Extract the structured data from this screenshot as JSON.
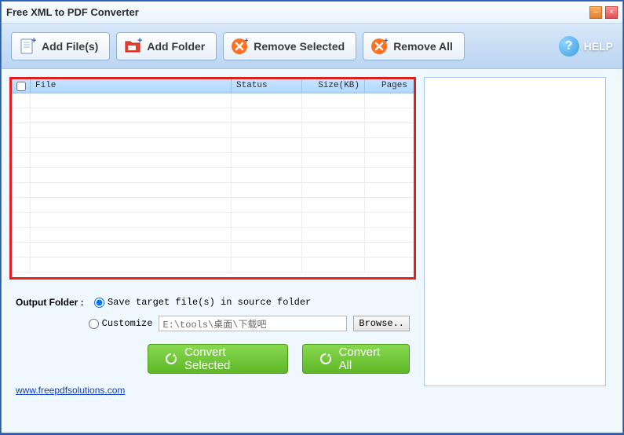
{
  "window": {
    "title": "Free XML to PDF Converter"
  },
  "toolbar": {
    "add_files": "Add File(s)",
    "add_folder": "Add Folder",
    "remove_selected": "Remove Selected",
    "remove_all": "Remove All",
    "help": "HELP"
  },
  "table": {
    "headers": {
      "file": "File",
      "status": "Status",
      "size": "Size(KB)",
      "pages": "Pages"
    },
    "rows": []
  },
  "output": {
    "label": "Output Folder :",
    "save_source": "Save target file(s) in source folder",
    "customize": "Customize",
    "path": "E:\\tools\\桌面\\下载吧",
    "browse": "Browse..",
    "selected_option": "save_source"
  },
  "actions": {
    "convert_selected": "Convert Selected",
    "convert_all": "Convert All"
  },
  "footer": {
    "link": "www.freepdfsolutions.com"
  }
}
